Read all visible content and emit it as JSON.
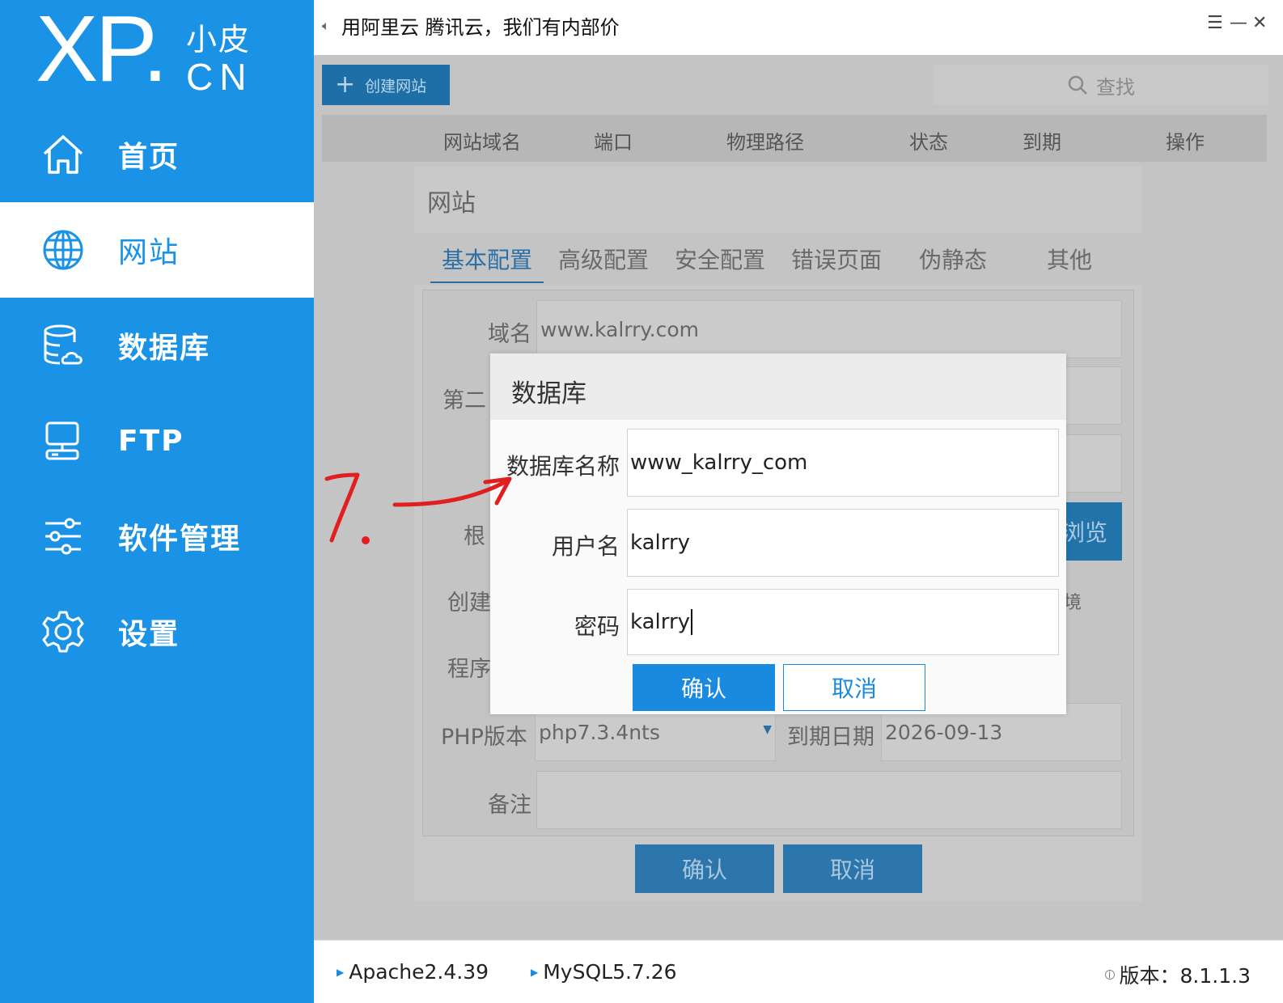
{
  "app": {
    "logo_main": "XP.",
    "logo_small_top": "小皮",
    "logo_small_bottom": "CN"
  },
  "sidebar": {
    "items": [
      {
        "label": "首页",
        "icon": "home-icon"
      },
      {
        "label": "网站",
        "icon": "globe-icon",
        "active": true
      },
      {
        "label": "数据库",
        "icon": "database-icon"
      },
      {
        "label": "FTP",
        "icon": "ftp-icon"
      },
      {
        "label": "软件管理",
        "icon": "sliders-icon"
      },
      {
        "label": "设置",
        "icon": "gear-icon"
      }
    ]
  },
  "topbar": {
    "ad_icon": "speaker-icon",
    "ad_text": "用阿里云 腾讯云，我们有内部价",
    "menu_glyph": "☰",
    "minimize_glyph": "—",
    "close_glyph": "✕"
  },
  "toolbar": {
    "create_label": "创建网站",
    "search_placeholder": "查找"
  },
  "table": {
    "headers": [
      "网站域名",
      "端口",
      "物理路径",
      "状态",
      "到期",
      "操作"
    ]
  },
  "site_modal": {
    "title": "网站",
    "tabs": [
      "基本配置",
      "高级配置",
      "安全配置",
      "错误页面",
      "伪静态",
      "其他"
    ],
    "active_tab": 0,
    "fields": {
      "domain_label": "域名",
      "domain_value": "www.kalrry.com",
      "second_label": "第二",
      "root_label": "根",
      "browse_label": "浏览",
      "create_label": "创建",
      "create_suffix": "境",
      "program_label": "程序",
      "php_label": "PHP版本",
      "php_value": "php7.3.4nts",
      "expire_label": "到期日期",
      "expire_value": "2026-09-13",
      "note_label": "备注",
      "note_value": ""
    },
    "ok_label": "确认",
    "cancel_label": "取消"
  },
  "db_dialog": {
    "title": "数据库",
    "name_label": "数据库名称",
    "name_value": "www_kalrry_com",
    "user_label": "用户名",
    "user_value": "kalrry",
    "password_label": "密码",
    "password_value": "kalrry",
    "ok_label": "确认",
    "cancel_label": "取消"
  },
  "annotation": {
    "text": "7.",
    "color": "#e02020"
  },
  "statusbar": {
    "apache": "Apache2.4.39",
    "mysql": "MySQL5.7.26",
    "version": "版本：8.1.1.3"
  },
  "colors": {
    "sidebar_bg": "#1a93e6",
    "accent": "#1a8ae0",
    "overlay_bg": "#c4c4c4"
  }
}
